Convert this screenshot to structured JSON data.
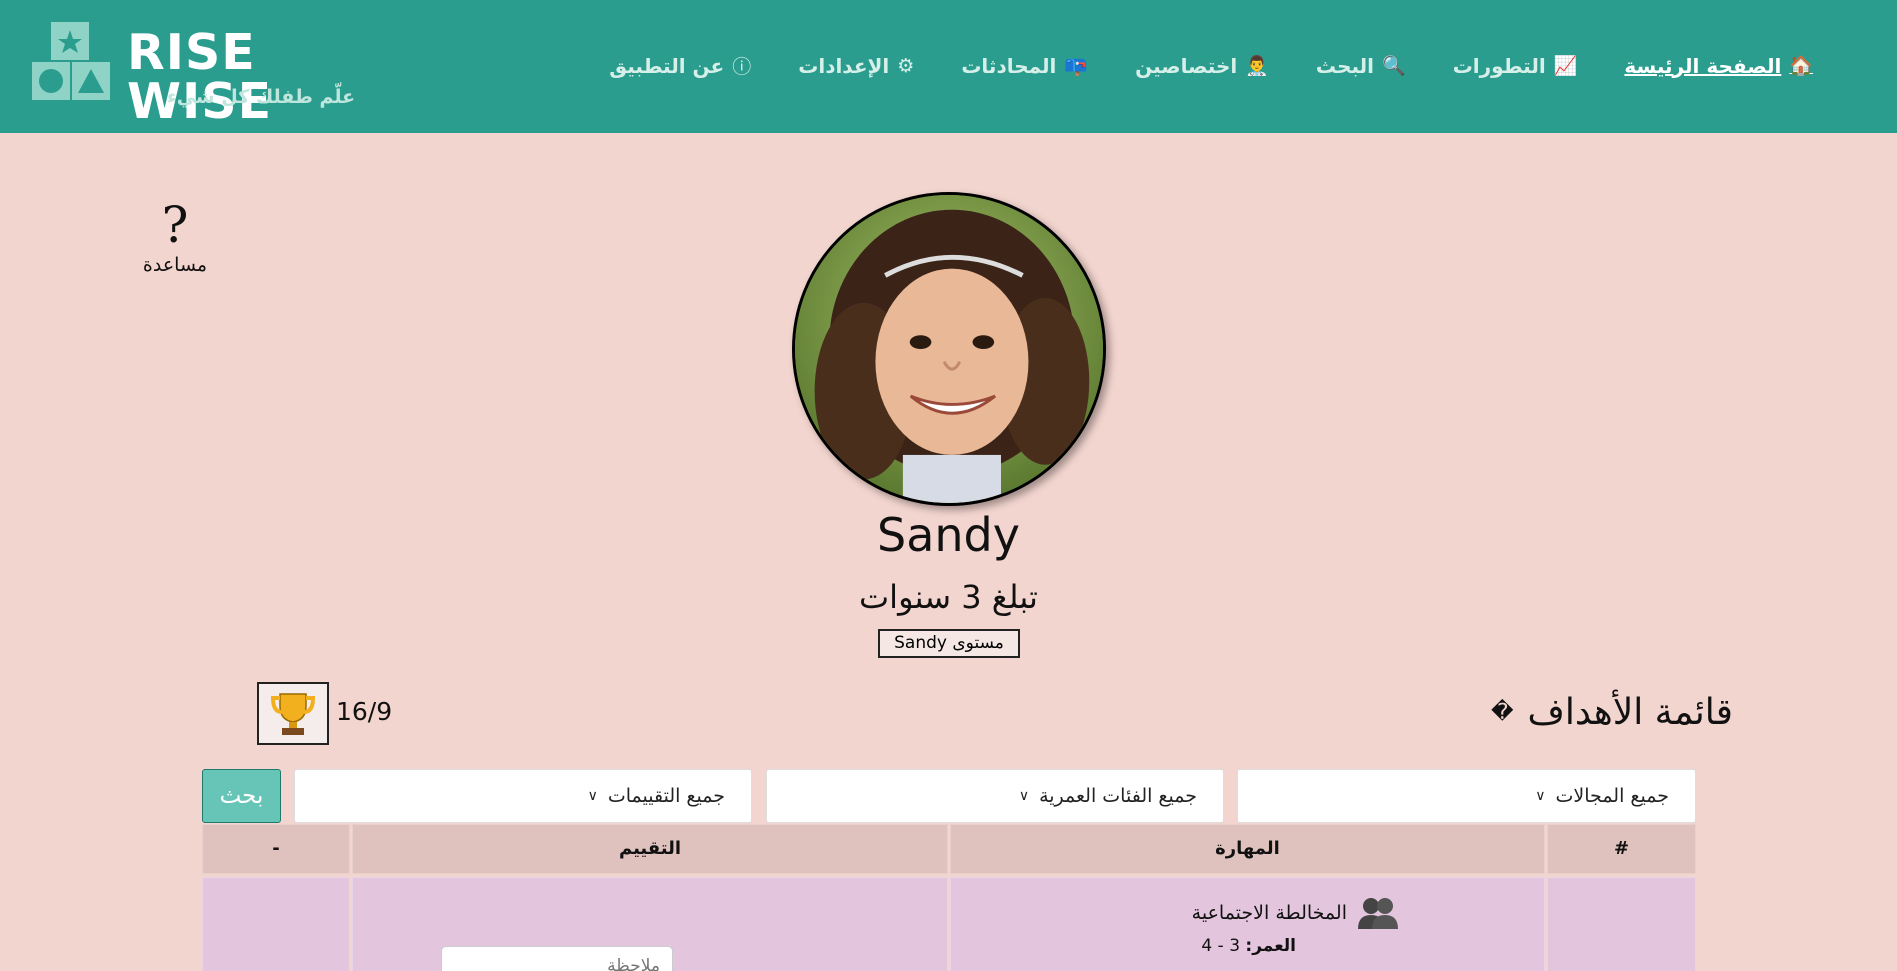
{
  "brand": {
    "name": "RISE WISE",
    "tagline": "علّم طفلك كل شيء"
  },
  "nav": {
    "items": [
      {
        "label": "الصفحة الرئيسة",
        "icon": "home-icon",
        "active": true
      },
      {
        "label": "التطورات",
        "icon": "chart-icon",
        "active": false
      },
      {
        "label": "البحث",
        "icon": "search-icon",
        "active": false
      },
      {
        "label": "اختصاصين",
        "icon": "specialist-icon",
        "active": false
      },
      {
        "label": "المحادثات",
        "icon": "mailbox-icon",
        "active": false
      },
      {
        "label": "الإعدادات",
        "icon": "gear-icon",
        "active": false
      },
      {
        "label": "عن التطبيق",
        "icon": "info-icon",
        "active": false
      }
    ]
  },
  "help": {
    "label": "مساعدة"
  },
  "profile": {
    "name": "Sandy",
    "age_text": "تبلغ 3 سنوات",
    "level_button": "مستوى Sandy"
  },
  "goals": {
    "title": "قائمة الأهداف",
    "mark": "�",
    "score": "16/9"
  },
  "filters": {
    "domains": "جميع المجالات",
    "age_groups": "جميع الفئات العمرية",
    "ratings": "جميع التقييمات",
    "search_label": "بحث"
  },
  "table": {
    "headers": {
      "num": "#",
      "skill": "المهارة",
      "rating": "التقييم",
      "dash": "-"
    },
    "rows": [
      {
        "skill": "المخالطة الاجتماعية",
        "age_label": "العمر:",
        "age_value": "3 - 4",
        "note_placeholder": "ملاحظة"
      }
    ]
  },
  "colors": {
    "header": "#2a9d8f",
    "background": "#f3d5cf",
    "table_header": "#dfc2bd",
    "row": "#e3c6de",
    "search_button": "#67c5b8"
  }
}
